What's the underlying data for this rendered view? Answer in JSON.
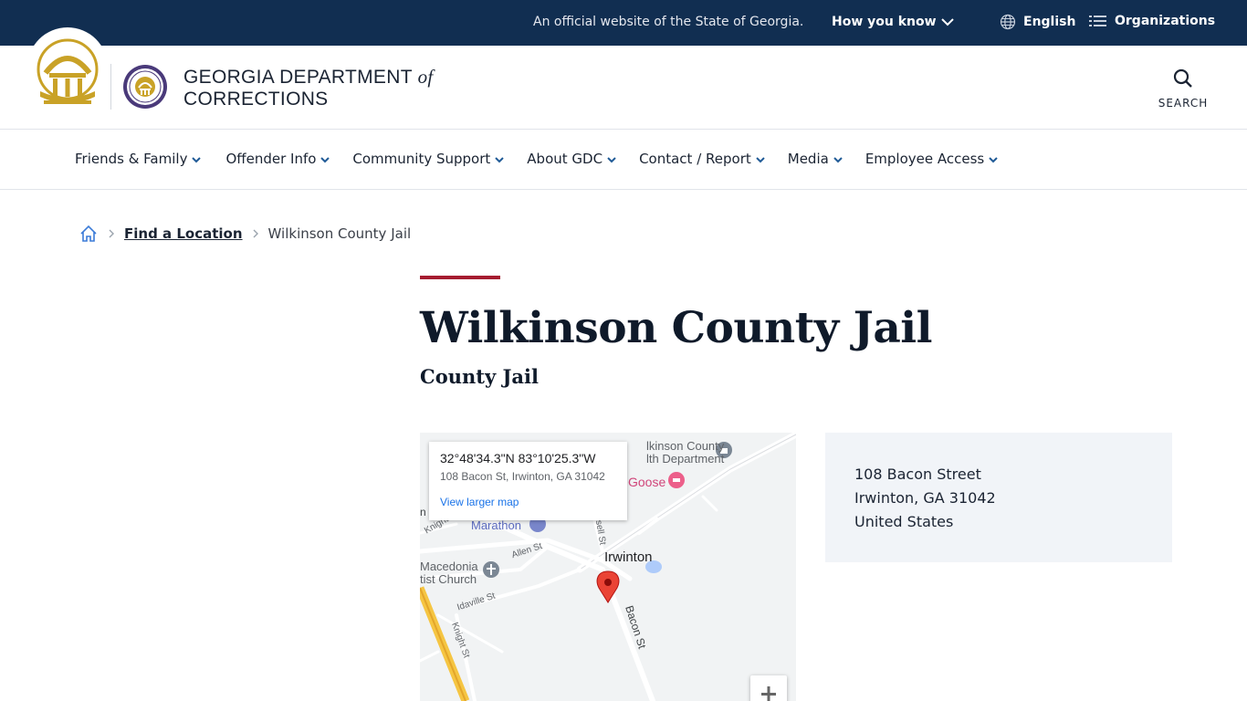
{
  "topbar": {
    "official_text": "An official website of the State of Georgia.",
    "how_you_know": "How you know",
    "language": "English",
    "organizations": "Organizations"
  },
  "header": {
    "agency_line1": "GEORGIA DEPARTMENT",
    "agency_of": "of",
    "agency_line2": "CORRECTIONS",
    "search_label": "SEARCH"
  },
  "nav": {
    "items": [
      {
        "label": "Friends & Family"
      },
      {
        "label": "Offender Info"
      },
      {
        "label": "Community Support"
      },
      {
        "label": "About GDC"
      },
      {
        "label": "Contact / Report"
      },
      {
        "label": "Media"
      },
      {
        "label": "Employee Access"
      }
    ]
  },
  "breadcrumb": {
    "link": "Find a Location",
    "current": "Wilkinson County Jail"
  },
  "page": {
    "title": "Wilkinson County Jail",
    "subtitle": "County Jail"
  },
  "map": {
    "coords": "32°48'34.3\"N 83°10'25.3\"W",
    "address": "108 Bacon St, Irwinton, GA 31042",
    "view_larger": "View larger map",
    "labels": {
      "health_dept_1": "lkinson County",
      "health_dept_2": "lth Department",
      "goose": "Goose",
      "marathon": "Marathon",
      "irwinton": "Irwinton",
      "macedonia_1": "Macedonia",
      "macedonia_2": "tist Church",
      "allen_st": "Allen St",
      "idaville_st": "Idaville St",
      "knight_st": "Knight St",
      "knight_short": "Knight",
      "bacon_st": "Bacon St",
      "sell_st": "sell St",
      "n_cut": "n"
    },
    "zoom_in": "+"
  },
  "address_card": {
    "line1": "108 Bacon Street",
    "line2": "Irwinton, GA 31042",
    "line3": "United States"
  },
  "colors": {
    "banner": "#112e51",
    "accent": "#a51c30",
    "gold": "#c9a227",
    "link_blue": "#1a73e8"
  }
}
